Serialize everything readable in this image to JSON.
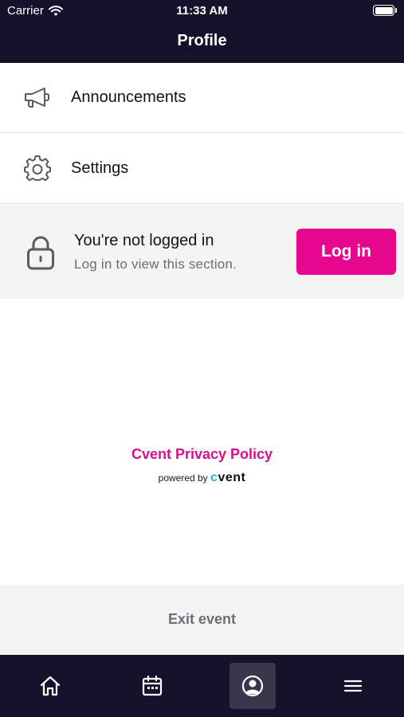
{
  "status_bar": {
    "carrier": "Carrier",
    "time": "11:33 AM"
  },
  "header": {
    "title": "Profile"
  },
  "menu": {
    "items": [
      {
        "label": "Announcements",
        "icon": "megaphone-icon"
      },
      {
        "label": "Settings",
        "icon": "gear-icon"
      }
    ]
  },
  "login": {
    "title": "You're not logged in",
    "subtitle": "Log in to view this section.",
    "button": "Log in",
    "icon": "lock-icon"
  },
  "footer": {
    "privacy_link": "Cvent Privacy Policy",
    "powered_by": "powered by",
    "brand_c": "c",
    "brand_rest": "vent"
  },
  "exit": {
    "label": "Exit event"
  },
  "tabbar": {
    "tabs": [
      {
        "icon": "home-icon",
        "active": false
      },
      {
        "icon": "calendar-icon",
        "active": false
      },
      {
        "icon": "profile-icon",
        "active": true
      },
      {
        "icon": "menu-icon",
        "active": false
      }
    ]
  },
  "colors": {
    "header_bg": "#14122b",
    "accent": "#e6078e",
    "panel_bg": "#f4f4f5"
  }
}
